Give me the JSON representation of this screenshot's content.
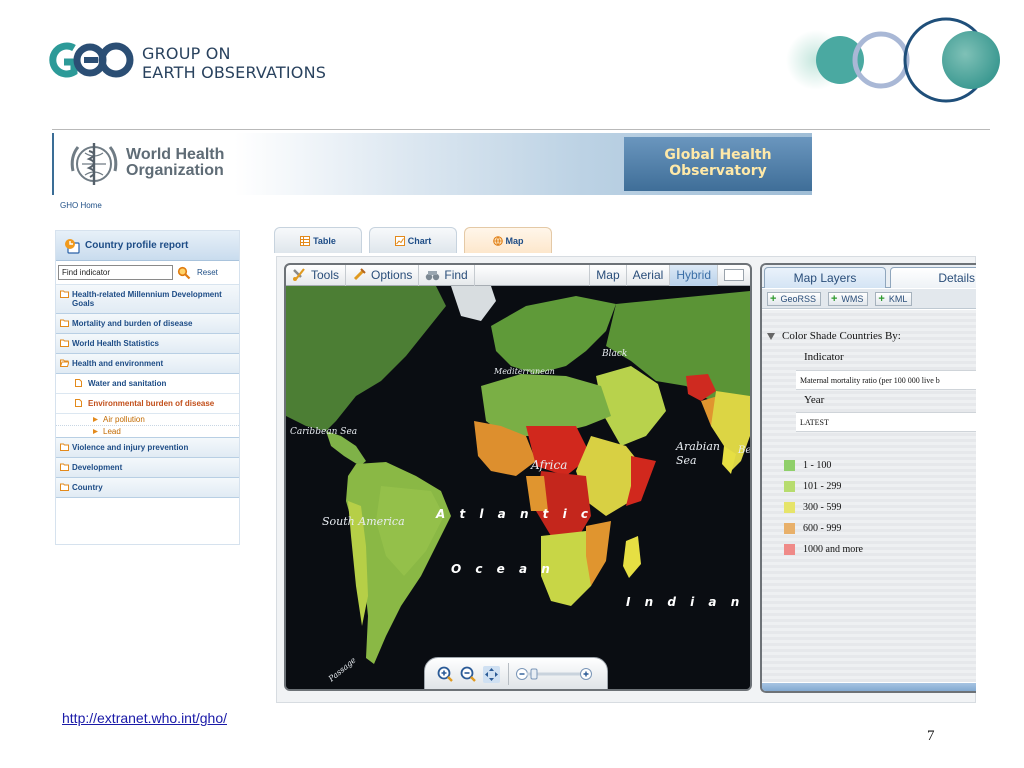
{
  "geo": {
    "line1": "GROUP ON",
    "line2": "EARTH OBSERVATIONS"
  },
  "who": {
    "name_line1": "World Health",
    "name_line2": "Organization",
    "observatory_line1": "Global Health",
    "observatory_line2": "Observatory",
    "home_link": "GHO Home"
  },
  "sidebar": {
    "header": "Country profile report",
    "find_placeholder": "Find indicator",
    "reset": "Reset",
    "items": [
      {
        "label": "Health-related Millennium Development Goals"
      },
      {
        "label": "Mortality and burden of disease"
      },
      {
        "label": "World Health Statistics"
      },
      {
        "label": "Health and environment"
      },
      {
        "label": "Water and sanitation"
      },
      {
        "label": "Environmental burden of disease"
      },
      {
        "label": "Air pollution"
      },
      {
        "label": "Lead"
      },
      {
        "label": "Violence and injury prevention"
      },
      {
        "label": "Development"
      },
      {
        "label": "Country"
      }
    ]
  },
  "tabs": [
    {
      "label": "Table"
    },
    {
      "label": "Chart"
    },
    {
      "label": "Map",
      "active": true
    }
  ],
  "map": {
    "toolbar": {
      "tools": "Tools",
      "options": "Options",
      "find": "Find"
    },
    "views": [
      "Map",
      "Aerial",
      "Hybrid"
    ],
    "active_view": "Hybrid",
    "labels": {
      "caribbean": "Caribbean Sea",
      "south_america": "South America",
      "mediterranean": "Mediterranean",
      "black": "Black",
      "arabian": "Arabian Sea",
      "africa": "Africa",
      "atlantic": "A t l a n t i c",
      "ocean": "O c e a n",
      "indian": "I n d i a n   O c e",
      "passage": "Passage",
      "be": "Be"
    },
    "colors": {
      "ocean": "#0a0d12",
      "land_green": "#5f9a39",
      "low": "#9acb4e",
      "mid_low": "#c5d84a",
      "mid": "#e6df43",
      "high": "#e0952f",
      "very_high": "#d1281d"
    }
  },
  "layers": {
    "tabs": [
      "Map Layers",
      "Details"
    ],
    "buttons": [
      "GeoRSS",
      "WMS",
      "KML"
    ],
    "section_title": "Color Shade Countries By:",
    "indicator_label": "Indicator",
    "indicator_value": "Maternal mortality ratio (per 100 000 live b",
    "year_label": "Year",
    "year_value": "LATEST",
    "legend": [
      {
        "label": "1 - 100",
        "color": "#8fcf6a"
      },
      {
        "label": "101 - 299",
        "color": "#b7dc6e"
      },
      {
        "label": "300 - 599",
        "color": "#e6e46a"
      },
      {
        "label": "600 - 999",
        "color": "#e8b06a"
      },
      {
        "label": "1000 and more",
        "color": "#ef8a88"
      }
    ]
  },
  "footer": {
    "url": "http://extranet.who.int/gho/",
    "page": "7"
  }
}
